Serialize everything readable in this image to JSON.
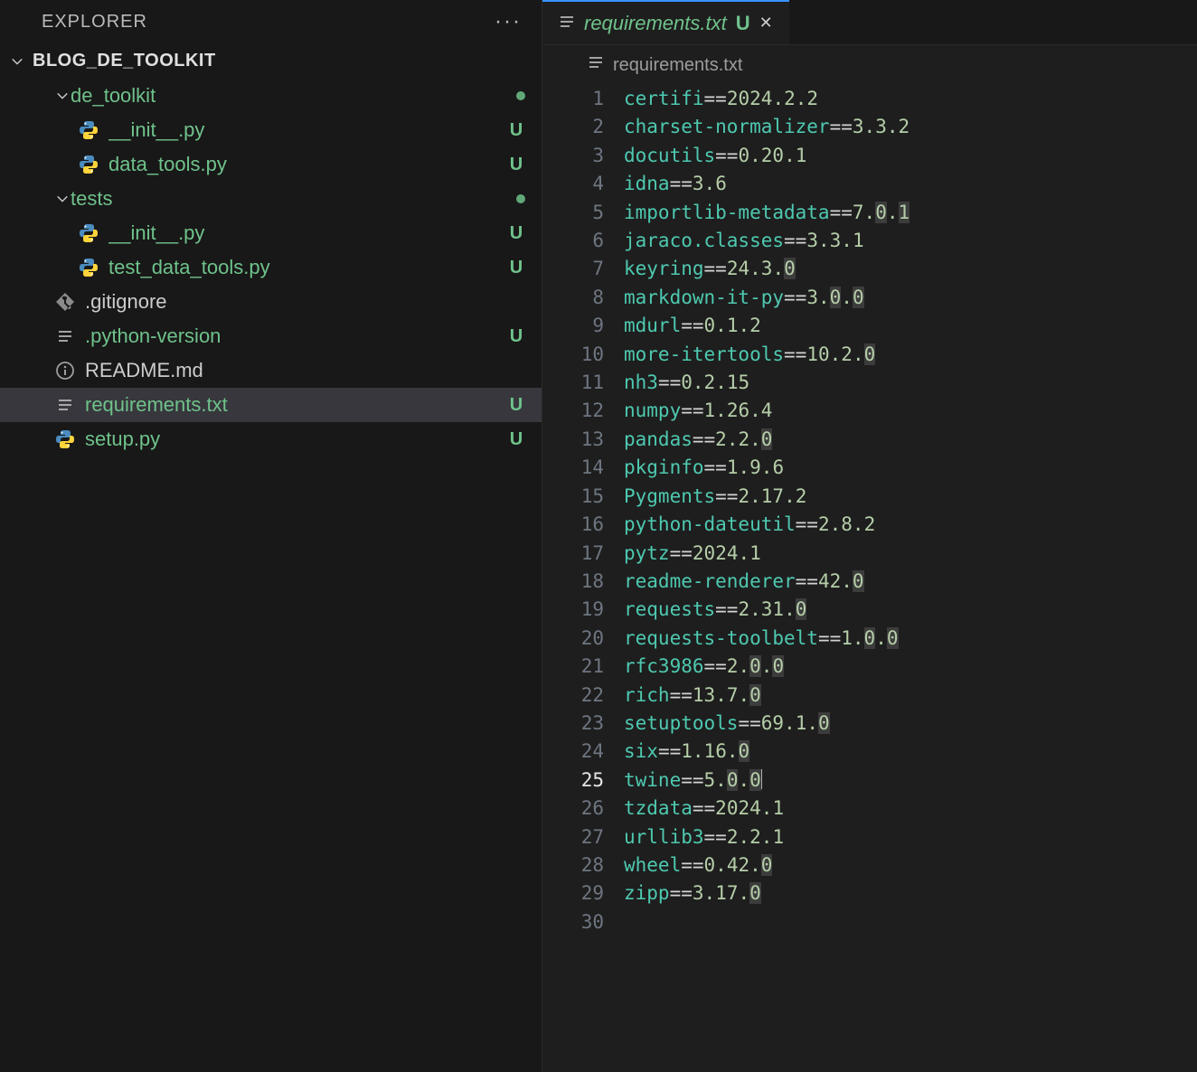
{
  "explorer": {
    "title": "EXPLORER",
    "project": "BLOG_DE_TOOLKIT",
    "tree": [
      {
        "id": "de_toolkit",
        "label": "de_toolkit",
        "kind": "folder",
        "indent": 1,
        "status": "dot",
        "color": "green",
        "open": true
      },
      {
        "id": "de_toolkit_init",
        "label": "__init__.py",
        "kind": "python",
        "indent": 2,
        "status": "U",
        "color": "green"
      },
      {
        "id": "data_tools",
        "label": "data_tools.py",
        "kind": "python",
        "indent": 2,
        "status": "U",
        "color": "green"
      },
      {
        "id": "tests",
        "label": "tests",
        "kind": "folder",
        "indent": 1,
        "status": "dot",
        "color": "green",
        "open": true
      },
      {
        "id": "tests_init",
        "label": "__init__.py",
        "kind": "python",
        "indent": 2,
        "status": "U",
        "color": "green"
      },
      {
        "id": "test_data_tools",
        "label": "test_data_tools.py",
        "kind": "python",
        "indent": 2,
        "status": "U",
        "color": "green"
      },
      {
        "id": "gitignore",
        "label": ".gitignore",
        "kind": "git",
        "indent": 1,
        "status": "",
        "color": "white"
      },
      {
        "id": "pyver",
        "label": ".python-version",
        "kind": "lines",
        "indent": 1,
        "status": "U",
        "color": "green"
      },
      {
        "id": "readme",
        "label": "README.md",
        "kind": "info",
        "indent": 1,
        "status": "",
        "color": "white"
      },
      {
        "id": "req",
        "label": "requirements.txt",
        "kind": "lines",
        "indent": 1,
        "status": "U",
        "color": "green",
        "selected": true
      },
      {
        "id": "setup",
        "label": "setup.py",
        "kind": "python",
        "indent": 1,
        "status": "U",
        "color": "green"
      }
    ]
  },
  "editor": {
    "tab": {
      "filename": "requirements.txt",
      "badge": "U"
    },
    "breadcrumb": "requirements.txt",
    "current_line": 25,
    "total_lines": 30,
    "packages": [
      {
        "name": "certifi",
        "version": "2024.2.2"
      },
      {
        "name": "charset-normalizer",
        "version": "3.3.2"
      },
      {
        "name": "docutils",
        "version": "0.20.1"
      },
      {
        "name": "idna",
        "version": "3.6"
      },
      {
        "name": "importlib-metadata",
        "version": "7.0.1",
        "hl": [
          2,
          4
        ]
      },
      {
        "name": "jaraco.classes",
        "version": "3.3.1"
      },
      {
        "name": "keyring",
        "version": "24.3.0",
        "hl": [
          5
        ]
      },
      {
        "name": "markdown-it-py",
        "version": "3.0.0",
        "hl": [
          2,
          4
        ]
      },
      {
        "name": "mdurl",
        "version": "0.1.2"
      },
      {
        "name": "more-itertools",
        "version": "10.2.0",
        "hl": [
          5
        ]
      },
      {
        "name": "nh3",
        "version": "0.2.15"
      },
      {
        "name": "numpy",
        "version": "1.26.4"
      },
      {
        "name": "pandas",
        "version": "2.2.0",
        "hl": [
          4
        ]
      },
      {
        "name": "pkginfo",
        "version": "1.9.6"
      },
      {
        "name": "Pygments",
        "version": "2.17.2"
      },
      {
        "name": "python-dateutil",
        "version": "2.8.2"
      },
      {
        "name": "pytz",
        "version": "2024.1"
      },
      {
        "name": "readme-renderer",
        "version": "42.0",
        "hl": [
          3
        ]
      },
      {
        "name": "requests",
        "version": "2.31.0",
        "hl": [
          5
        ]
      },
      {
        "name": "requests-toolbelt",
        "version": "1.0.0",
        "hl": [
          2,
          4
        ]
      },
      {
        "name": "rfc3986",
        "version": "2.0.0",
        "hl": [
          2,
          4
        ]
      },
      {
        "name": "rich",
        "version": "13.7.0",
        "hl": [
          5
        ]
      },
      {
        "name": "setuptools",
        "version": "69.1.0",
        "hl": [
          5
        ]
      },
      {
        "name": "six",
        "version": "1.16.0",
        "hl": [
          5
        ]
      },
      {
        "name": "twine",
        "version": "5.0.0",
        "hl": [
          2,
          4
        ],
        "cursor": true
      },
      {
        "name": "tzdata",
        "version": "2024.1"
      },
      {
        "name": "urllib3",
        "version": "2.2.1"
      },
      {
        "name": "wheel",
        "version": "0.42.0",
        "hl": [
          5
        ]
      },
      {
        "name": "zipp",
        "version": "3.17.0",
        "hl": [
          5
        ]
      }
    ]
  }
}
